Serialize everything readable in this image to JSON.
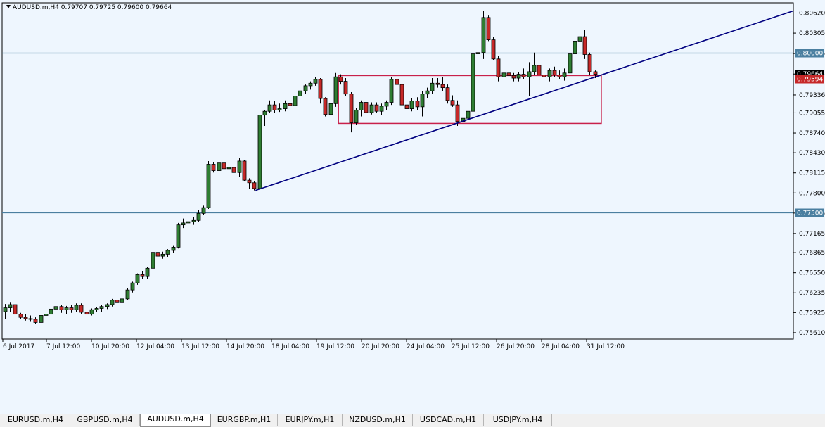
{
  "symbol_info": "AUDUSD.m,H4  0.79707 0.79725 0.79600 0.79664",
  "tabs": [
    {
      "label": "EURUSD.m,H4",
      "active": false
    },
    {
      "label": "GBPUSD.m,H4",
      "active": false
    },
    {
      "label": "AUDUSD.m,H4",
      "active": true
    },
    {
      "label": "EURGBP.m,H1",
      "active": false
    },
    {
      "label": "EURJPY.m,H1",
      "active": false
    },
    {
      "label": "NZDUSD.m,H1",
      "active": false
    },
    {
      "label": "USDCAD.m,H1",
      "active": false
    },
    {
      "label": "USDJPY.m,H4",
      "active": false
    }
  ],
  "chart_data": {
    "type": "candlestick",
    "symbol": "AUDUSD.m",
    "timeframe": "H4",
    "y_ticks": [
      "0.80620",
      "0.80305",
      "0.79985",
      "0.79664",
      "0.79336",
      "0.79055",
      "0.78740",
      "0.78430",
      "0.78115",
      "0.77800",
      "0.77485",
      "0.77165",
      "0.76865",
      "0.76550",
      "0.76235",
      "0.75925",
      "0.75610"
    ],
    "y_range": [
      0.7551,
      0.8078
    ],
    "x_ticks": [
      "6 Jul 2017",
      "7 Jul 12:00",
      "10 Jul 20:00",
      "12 Jul 04:00",
      "13 Jul 12:00",
      "14 Jul 20:00",
      "18 Jul 04:00",
      "19 Jul 12:00",
      "20 Jul 20:00",
      "24 Jul 04:00",
      "25 Jul 12:00",
      "26 Jul 20:00",
      "28 Jul 04:00",
      "31 Jul 12:00"
    ],
    "bullish_color": "#2e7d32",
    "bearish_color": "#c62828",
    "horizontal_lines": [
      {
        "price": 0.8,
        "label": "0.80000",
        "color": "#4a7fa0"
      },
      {
        "price": 0.775,
        "label": "0.77500",
        "color": "#4a7fa0"
      }
    ],
    "bid_line": {
      "price": 0.79594,
      "label": "0.79594",
      "color": "#c62828"
    },
    "last_price_label": "0.79664",
    "trendline": {
      "from": {
        "date": "18 Jul 2017",
        "price": 0.7784
      },
      "to": {
        "date": "2 Aug 2017",
        "price": 0.8065
      },
      "color": "#000080"
    },
    "rectangle": {
      "from_date": "19 Jul 2017",
      "to_date": "1 Aug 2017",
      "price_top": 0.7964,
      "price_bottom": 0.7889,
      "color": "#c8204a"
    },
    "candles": [
      {
        "o": 0.7594,
        "h": 0.7606,
        "l": 0.7583,
        "c": 0.76
      },
      {
        "o": 0.76,
        "h": 0.7608,
        "l": 0.7594,
        "c": 0.7605
      },
      {
        "o": 0.7605,
        "h": 0.7609,
        "l": 0.7588,
        "c": 0.759
      },
      {
        "o": 0.759,
        "h": 0.7592,
        "l": 0.7582,
        "c": 0.7585
      },
      {
        "o": 0.7585,
        "h": 0.759,
        "l": 0.758,
        "c": 0.7583
      },
      {
        "o": 0.7583,
        "h": 0.7588,
        "l": 0.7578,
        "c": 0.7582
      },
      {
        "o": 0.7582,
        "h": 0.7585,
        "l": 0.7575,
        "c": 0.7577
      },
      {
        "o": 0.7577,
        "h": 0.759,
        "l": 0.7576,
        "c": 0.7588
      },
      {
        "o": 0.7588,
        "h": 0.7593,
        "l": 0.758,
        "c": 0.759
      },
      {
        "o": 0.759,
        "h": 0.7615,
        "l": 0.7588,
        "c": 0.7598
      },
      {
        "o": 0.7598,
        "h": 0.7604,
        "l": 0.759,
        "c": 0.7602
      },
      {
        "o": 0.7602,
        "h": 0.7605,
        "l": 0.7592,
        "c": 0.7597
      },
      {
        "o": 0.7597,
        "h": 0.7603,
        "l": 0.759,
        "c": 0.76
      },
      {
        "o": 0.76,
        "h": 0.7605,
        "l": 0.7592,
        "c": 0.7597
      },
      {
        "o": 0.7597,
        "h": 0.7607,
        "l": 0.7594,
        "c": 0.7604
      },
      {
        "o": 0.7604,
        "h": 0.7607,
        "l": 0.759,
        "c": 0.7593
      },
      {
        "o": 0.7593,
        "h": 0.7597,
        "l": 0.7586,
        "c": 0.759
      },
      {
        "o": 0.759,
        "h": 0.7599,
        "l": 0.7588,
        "c": 0.7597
      },
      {
        "o": 0.7597,
        "h": 0.7601,
        "l": 0.7593,
        "c": 0.7599
      },
      {
        "o": 0.7599,
        "h": 0.7605,
        "l": 0.7594,
        "c": 0.7602
      },
      {
        "o": 0.7602,
        "h": 0.7607,
        "l": 0.7598,
        "c": 0.7605
      },
      {
        "o": 0.7605,
        "h": 0.7614,
        "l": 0.7602,
        "c": 0.7612
      },
      {
        "o": 0.7612,
        "h": 0.7614,
        "l": 0.7604,
        "c": 0.7608
      },
      {
        "o": 0.7608,
        "h": 0.7616,
        "l": 0.7603,
        "c": 0.7614
      },
      {
        "o": 0.7614,
        "h": 0.7631,
        "l": 0.7612,
        "c": 0.7628
      },
      {
        "o": 0.7628,
        "h": 0.7641,
        "l": 0.7624,
        "c": 0.7639
      },
      {
        "o": 0.7639,
        "h": 0.7654,
        "l": 0.7636,
        "c": 0.7652
      },
      {
        "o": 0.7652,
        "h": 0.7658,
        "l": 0.7645,
        "c": 0.7649
      },
      {
        "o": 0.7649,
        "h": 0.7664,
        "l": 0.7645,
        "c": 0.7662
      },
      {
        "o": 0.7662,
        "h": 0.769,
        "l": 0.766,
        "c": 0.7687
      },
      {
        "o": 0.7687,
        "h": 0.769,
        "l": 0.7678,
        "c": 0.7681
      },
      {
        "o": 0.7681,
        "h": 0.7688,
        "l": 0.7677,
        "c": 0.7684
      },
      {
        "o": 0.7684,
        "h": 0.7692,
        "l": 0.768,
        "c": 0.769
      },
      {
        "o": 0.769,
        "h": 0.7698,
        "l": 0.7686,
        "c": 0.7695
      },
      {
        "o": 0.7695,
        "h": 0.7733,
        "l": 0.7693,
        "c": 0.773
      },
      {
        "o": 0.773,
        "h": 0.774,
        "l": 0.7725,
        "c": 0.7733
      },
      {
        "o": 0.7733,
        "h": 0.7742,
        "l": 0.7728,
        "c": 0.7735
      },
      {
        "o": 0.7735,
        "h": 0.7742,
        "l": 0.773,
        "c": 0.7737
      },
      {
        "o": 0.7737,
        "h": 0.7753,
        "l": 0.7735,
        "c": 0.7748
      },
      {
        "o": 0.7748,
        "h": 0.776,
        "l": 0.7745,
        "c": 0.7757
      },
      {
        "o": 0.7757,
        "h": 0.783,
        "l": 0.7755,
        "c": 0.7825
      },
      {
        "o": 0.7825,
        "h": 0.7828,
        "l": 0.7812,
        "c": 0.7815
      },
      {
        "o": 0.7815,
        "h": 0.7832,
        "l": 0.781,
        "c": 0.7827
      },
      {
        "o": 0.7827,
        "h": 0.7832,
        "l": 0.7815,
        "c": 0.7818
      },
      {
        "o": 0.7818,
        "h": 0.7825,
        "l": 0.7812,
        "c": 0.782
      },
      {
        "o": 0.782,
        "h": 0.7822,
        "l": 0.7808,
        "c": 0.7812
      },
      {
        "o": 0.7812,
        "h": 0.7835,
        "l": 0.7805,
        "c": 0.783
      },
      {
        "o": 0.783,
        "h": 0.7832,
        "l": 0.7798,
        "c": 0.78
      },
      {
        "o": 0.78,
        "h": 0.7803,
        "l": 0.7786,
        "c": 0.7796
      },
      {
        "o": 0.7796,
        "h": 0.7798,
        "l": 0.7784,
        "c": 0.7787
      },
      {
        "o": 0.7787,
        "h": 0.7905,
        "l": 0.7785,
        "c": 0.7902
      },
      {
        "o": 0.7902,
        "h": 0.791,
        "l": 0.7885,
        "c": 0.7908
      },
      {
        "o": 0.7908,
        "h": 0.7925,
        "l": 0.7905,
        "c": 0.7918
      },
      {
        "o": 0.7918,
        "h": 0.7924,
        "l": 0.7906,
        "c": 0.791
      },
      {
        "o": 0.791,
        "h": 0.792,
        "l": 0.7907,
        "c": 0.7912
      },
      {
        "o": 0.7912,
        "h": 0.7925,
        "l": 0.7908,
        "c": 0.792
      },
      {
        "o": 0.792,
        "h": 0.7927,
        "l": 0.7912,
        "c": 0.7917
      },
      {
        "o": 0.7917,
        "h": 0.7935,
        "l": 0.7915,
        "c": 0.7932
      },
      {
        "o": 0.7932,
        "h": 0.7945,
        "l": 0.7928,
        "c": 0.794
      },
      {
        "o": 0.794,
        "h": 0.795,
        "l": 0.7935,
        "c": 0.7948
      },
      {
        "o": 0.7948,
        "h": 0.7955,
        "l": 0.7942,
        "c": 0.7952
      },
      {
        "o": 0.7952,
        "h": 0.7962,
        "l": 0.7948,
        "c": 0.7958
      },
      {
        "o": 0.7958,
        "h": 0.796,
        "l": 0.792,
        "c": 0.7928
      },
      {
        "o": 0.7928,
        "h": 0.793,
        "l": 0.79,
        "c": 0.7903
      },
      {
        "o": 0.7903,
        "h": 0.7925,
        "l": 0.7898,
        "c": 0.792
      },
      {
        "o": 0.792,
        "h": 0.7968,
        "l": 0.7915,
        "c": 0.7962
      },
      {
        "o": 0.7962,
        "h": 0.7966,
        "l": 0.795,
        "c": 0.7955
      },
      {
        "o": 0.7955,
        "h": 0.796,
        "l": 0.7932,
        "c": 0.7935
      },
      {
        "o": 0.7935,
        "h": 0.7938,
        "l": 0.7875,
        "c": 0.789
      },
      {
        "o": 0.789,
        "h": 0.7913,
        "l": 0.7887,
        "c": 0.791
      },
      {
        "o": 0.791,
        "h": 0.7925,
        "l": 0.79,
        "c": 0.7922
      },
      {
        "o": 0.7922,
        "h": 0.793,
        "l": 0.7902,
        "c": 0.7906
      },
      {
        "o": 0.7906,
        "h": 0.7922,
        "l": 0.7903,
        "c": 0.7918
      },
      {
        "o": 0.7918,
        "h": 0.7922,
        "l": 0.7905,
        "c": 0.7908
      },
      {
        "o": 0.7908,
        "h": 0.792,
        "l": 0.7902,
        "c": 0.7916
      },
      {
        "o": 0.7916,
        "h": 0.7925,
        "l": 0.791,
        "c": 0.7922
      },
      {
        "o": 0.7922,
        "h": 0.7962,
        "l": 0.7918,
        "c": 0.7958
      },
      {
        "o": 0.7958,
        "h": 0.7966,
        "l": 0.7945,
        "c": 0.795
      },
      {
        "o": 0.795,
        "h": 0.7955,
        "l": 0.7915,
        "c": 0.7918
      },
      {
        "o": 0.7918,
        "h": 0.7925,
        "l": 0.7905,
        "c": 0.7912
      },
      {
        "o": 0.7912,
        "h": 0.7928,
        "l": 0.7908,
        "c": 0.7924
      },
      {
        "o": 0.7924,
        "h": 0.793,
        "l": 0.791,
        "c": 0.7915
      },
      {
        "o": 0.7915,
        "h": 0.794,
        "l": 0.79,
        "c": 0.7935
      },
      {
        "o": 0.7935,
        "h": 0.7945,
        "l": 0.7928,
        "c": 0.794
      },
      {
        "o": 0.794,
        "h": 0.796,
        "l": 0.7935,
        "c": 0.7952
      },
      {
        "o": 0.7952,
        "h": 0.796,
        "l": 0.7945,
        "c": 0.795
      },
      {
        "o": 0.795,
        "h": 0.7962,
        "l": 0.794,
        "c": 0.7945
      },
      {
        "o": 0.7945,
        "h": 0.795,
        "l": 0.792,
        "c": 0.7925
      },
      {
        "o": 0.7925,
        "h": 0.7933,
        "l": 0.7915,
        "c": 0.7918
      },
      {
        "o": 0.7918,
        "h": 0.7925,
        "l": 0.7885,
        "c": 0.7892
      },
      {
        "o": 0.7892,
        "h": 0.7902,
        "l": 0.7875,
        "c": 0.7897
      },
      {
        "o": 0.7897,
        "h": 0.7912,
        "l": 0.7895,
        "c": 0.7908
      },
      {
        "o": 0.7908,
        "h": 0.8,
        "l": 0.7905,
        "c": 0.7998
      },
      {
        "o": 0.7998,
        "h": 0.8005,
        "l": 0.7985,
        "c": 0.8
      },
      {
        "o": 0.8,
        "h": 0.8065,
        "l": 0.799,
        "c": 0.8055
      },
      {
        "o": 0.8055,
        "h": 0.8058,
        "l": 0.8018,
        "c": 0.802
      },
      {
        "o": 0.802,
        "h": 0.8025,
        "l": 0.7988,
        "c": 0.799
      },
      {
        "o": 0.799,
        "h": 0.7995,
        "l": 0.7955,
        "c": 0.7962
      },
      {
        "o": 0.7962,
        "h": 0.7975,
        "l": 0.7957,
        "c": 0.7968
      },
      {
        "o": 0.7968,
        "h": 0.7972,
        "l": 0.7957,
        "c": 0.7964
      },
      {
        "o": 0.7964,
        "h": 0.7968,
        "l": 0.7955,
        "c": 0.796
      },
      {
        "o": 0.796,
        "h": 0.797,
        "l": 0.7955,
        "c": 0.7966
      },
      {
        "o": 0.7966,
        "h": 0.7975,
        "l": 0.7958,
        "c": 0.7962
      },
      {
        "o": 0.7962,
        "h": 0.7985,
        "l": 0.7932,
        "c": 0.797
      },
      {
        "o": 0.797,
        "h": 0.8,
        "l": 0.7965,
        "c": 0.798
      },
      {
        "o": 0.798,
        "h": 0.7985,
        "l": 0.7962,
        "c": 0.7965
      },
      {
        "o": 0.7965,
        "h": 0.7975,
        "l": 0.7955,
        "c": 0.7962
      },
      {
        "o": 0.7962,
        "h": 0.7975,
        "l": 0.7955,
        "c": 0.7972
      },
      {
        "o": 0.7972,
        "h": 0.7978,
        "l": 0.7962,
        "c": 0.7965
      },
      {
        "o": 0.7965,
        "h": 0.7972,
        "l": 0.7958,
        "c": 0.7962
      },
      {
        "o": 0.7962,
        "h": 0.7975,
        "l": 0.7956,
        "c": 0.7968
      },
      {
        "o": 0.7968,
        "h": 0.8,
        "l": 0.7965,
        "c": 0.7998
      },
      {
        "o": 0.7998,
        "h": 0.8025,
        "l": 0.7995,
        "c": 0.8018
      },
      {
        "o": 0.8018,
        "h": 0.8042,
        "l": 0.801,
        "c": 0.8025
      },
      {
        "o": 0.8025,
        "h": 0.8035,
        "l": 0.799,
        "c": 0.7997
      },
      {
        "o": 0.7997,
        "h": 0.8,
        "l": 0.7965,
        "c": 0.797
      },
      {
        "o": 0.797,
        "h": 0.7972,
        "l": 0.796,
        "c": 0.7966
      }
    ]
  }
}
